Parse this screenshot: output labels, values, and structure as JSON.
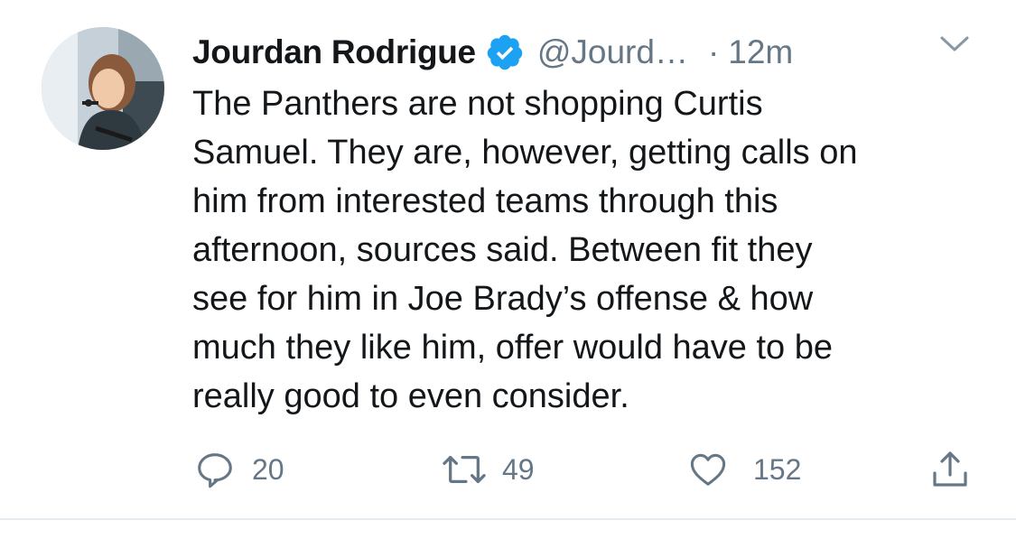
{
  "tweet": {
    "author": {
      "display_name": "Jourdan Rodrigue",
      "handle": "@Jourd…",
      "verified": true
    },
    "separator": "·",
    "time": "12m",
    "text_lines": [
      "The Panthers are not shopping Curtis",
      "Samuel. They are, however, getting calls on",
      "him from interested teams through this",
      "afternoon, sources said. Between fit they",
      "see for him in Joe Brady’s offense & how",
      "much they like him, offer would have to be",
      "really good to even consider."
    ],
    "actions": {
      "replies": "20",
      "retweets": "49",
      "likes": "152"
    }
  },
  "icons": {
    "verified": "verified-badge-icon",
    "menu": "chevron-down-icon",
    "reply": "reply-icon",
    "retweet": "retweet-icon",
    "like": "heart-icon",
    "share": "share-icon"
  },
  "colors": {
    "text": "#14171a",
    "muted": "#657786",
    "verified": "#1da1f2"
  }
}
